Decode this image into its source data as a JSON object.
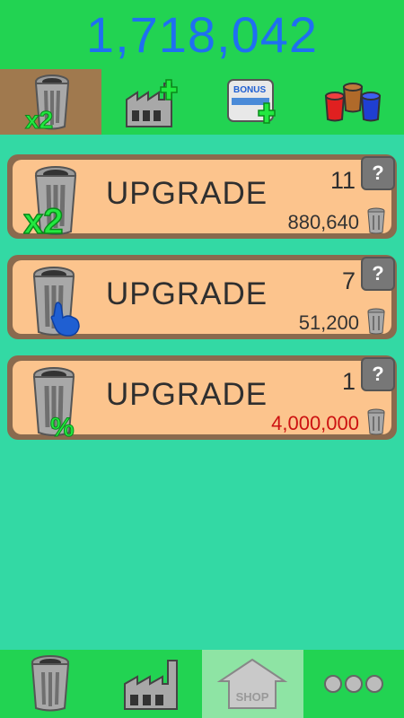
{
  "score": "1,718,042",
  "tabs": [
    {
      "name": "multiplier-upgrades",
      "icon": "trash-can-x2-icon",
      "active": true
    },
    {
      "name": "factory-plus",
      "icon": "factory-plus-icon",
      "active": false
    },
    {
      "name": "bonus-plus",
      "icon": "bonus-card-plus-icon",
      "active": false,
      "icon_text": "BONUS"
    },
    {
      "name": "colored-cans",
      "icon": "colored-cans-icon",
      "active": false
    }
  ],
  "upgrades": [
    {
      "title": "UPGRADE",
      "level": "11",
      "cost": "880,640",
      "icon": "trash-can-x2-icon",
      "icon_text": "x2",
      "affordable": true,
      "help": "?"
    },
    {
      "title": "UPGRADE",
      "level": "7",
      "cost": "51,200",
      "icon": "trash-can-tap-icon",
      "affordable": true,
      "help": "?"
    },
    {
      "title": "UPGRADE",
      "level": "1",
      "cost": "4,000,000",
      "icon": "trash-can-percent-icon",
      "icon_text": "%",
      "affordable": false,
      "help": "?"
    }
  ],
  "bottom_nav": [
    {
      "name": "trash-can",
      "icon": "trash-can-icon",
      "active": false
    },
    {
      "name": "factory",
      "icon": "factory-icon",
      "active": false
    },
    {
      "name": "shop",
      "icon": "shop-house-icon",
      "label": "SHOP",
      "active": true
    },
    {
      "name": "more",
      "icon": "more-dots-icon",
      "active": false
    }
  ],
  "colors": {
    "score": "#1f6ff2",
    "bar": "#22d352",
    "background": "#33d9a4",
    "card": "#fcc48d",
    "unaffordable": "#cc1111"
  }
}
